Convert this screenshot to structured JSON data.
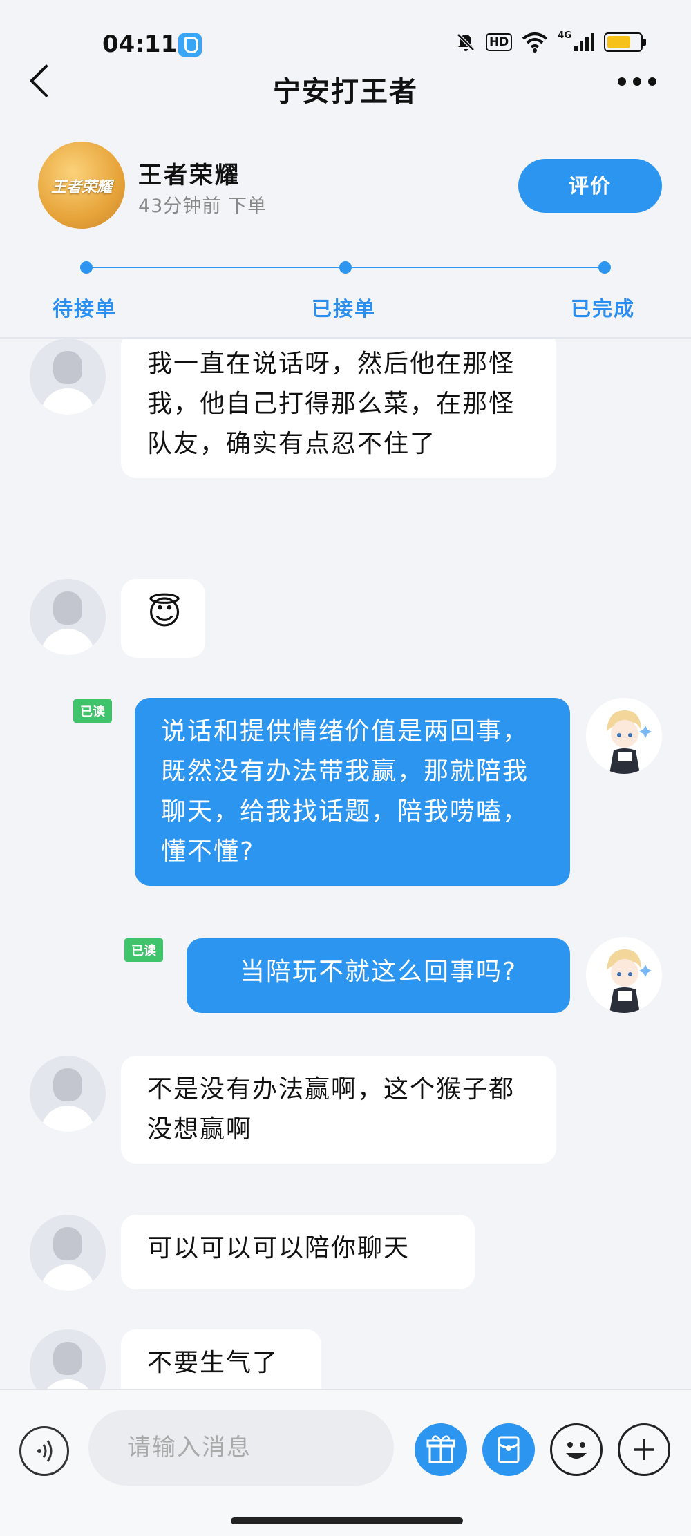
{
  "status_bar": {
    "time": "04:11",
    "hd_label": "HD",
    "network": "4G",
    "battery_level": 0.75,
    "icons": [
      "app-icon",
      "mute-bell-icon",
      "wifi-icon",
      "signal-icon",
      "battery-icon"
    ]
  },
  "header": {
    "title": "宁安打王者",
    "icons": [
      "back-icon",
      "more-icon"
    ]
  },
  "order": {
    "game_name": "王者荣耀",
    "game_logo_text": "王者荣耀",
    "time_ago": "43分钟前 下单",
    "rate_button": "评价",
    "steps": [
      "待接单",
      "已接单",
      "已完成"
    ]
  },
  "messages": [
    {
      "side": "other",
      "text": "我一直在说话呀，然后他在那怪我，他自己打得那么菜，在那怪队友，确实有点忍不住了"
    },
    {
      "side": "other",
      "text": "😇"
    },
    {
      "side": "me",
      "tag": "已读",
      "text": "说话和提供情绪价值是两回事，既然没有办法带我赢，那就陪我聊天，给我找话题，陪我唠嗑，懂不懂?"
    },
    {
      "side": "me",
      "tag": "已读",
      "text": "当陪玩不就这么回事吗?"
    },
    {
      "side": "other",
      "text": "不是没有办法赢啊，这个猴子都没想赢啊"
    },
    {
      "side": "other",
      "text": "可以可以可以陪你聊天"
    },
    {
      "side": "other",
      "text": "不要生气了"
    }
  ],
  "composer": {
    "placeholder": "请输入消息",
    "icons": [
      "voice-icon",
      "gift-icon",
      "red-packet-icon",
      "emoji-icon",
      "plus-icon"
    ]
  },
  "colors": {
    "accent": "#2b95f0",
    "read_tag": "#3fc46b",
    "background": "#f2f4f8"
  }
}
